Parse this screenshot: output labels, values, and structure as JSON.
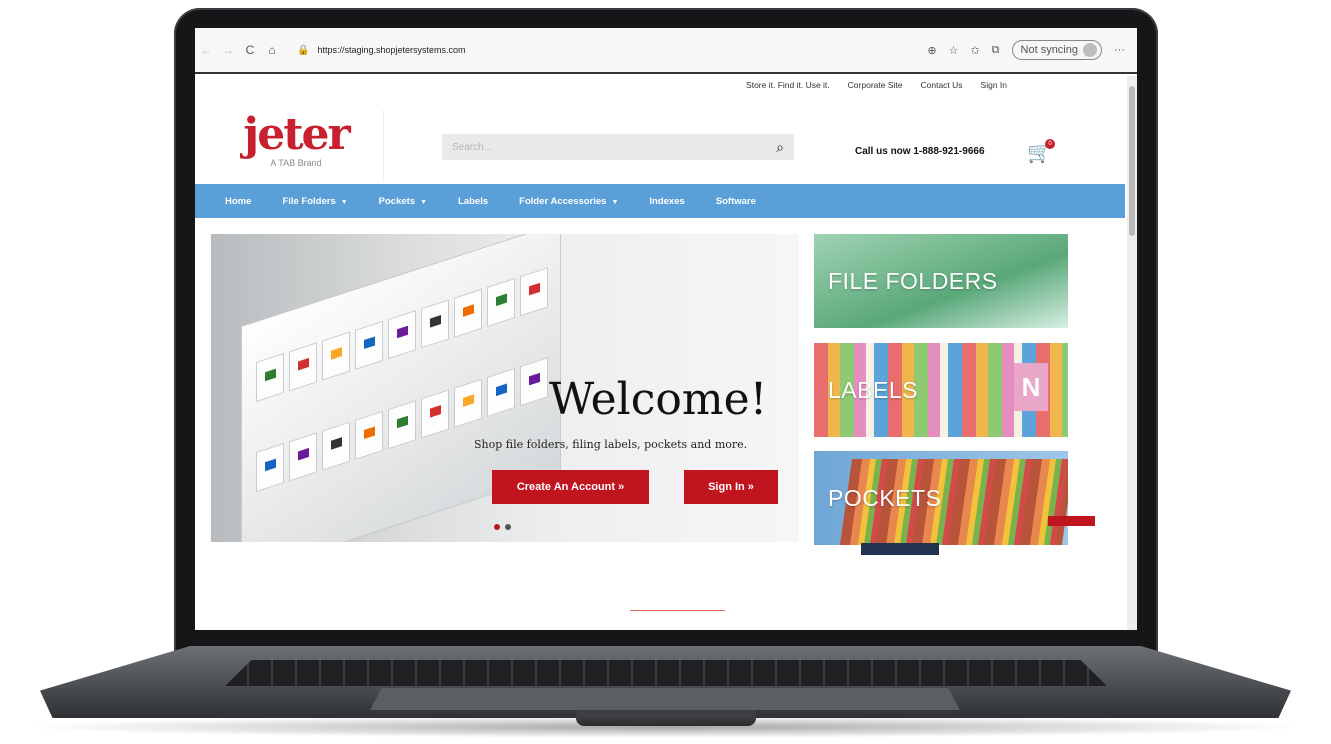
{
  "browser": {
    "back": "←",
    "forward": "→",
    "reload": "C",
    "home": "⌂",
    "lock": "🔒",
    "url": "https://staging.shopjetersystems.com",
    "sync_label": "Not syncing",
    "more": "···"
  },
  "topbar": {
    "links": [
      "Store it. Find it. Use it.",
      "Corporate Site",
      "Contact Us",
      "Sign In"
    ]
  },
  "header": {
    "logo_text": "jeter",
    "logo_sub": "A TAB Brand",
    "search_placeholder": "Search...",
    "phone": "Call us now 1-888-921-9666",
    "cart_count": "0"
  },
  "nav": {
    "items": [
      {
        "label": "Home",
        "dropdown": false
      },
      {
        "label": "File Folders",
        "dropdown": true
      },
      {
        "label": "Pockets",
        "dropdown": true
      },
      {
        "label": "Labels",
        "dropdown": false
      },
      {
        "label": "Folder Accessories",
        "dropdown": true
      },
      {
        "label": "Indexes",
        "dropdown": false
      },
      {
        "label": "Software",
        "dropdown": false
      }
    ]
  },
  "hero": {
    "title": "Welcome!",
    "subtitle": "Shop file folders, filing labels, pockets and more.",
    "create_button": "Create An Account »",
    "signin_button": "Sign In »"
  },
  "tiles": {
    "file_folders": "FILE FOLDERS",
    "labels": "LABELS",
    "pockets": "POCKETS",
    "labels_tab_letter": "N"
  },
  "colors": {
    "brand_red": "#c8202e",
    "nav_blue": "#5a9fd8",
    "button_red": "#c0141f"
  }
}
